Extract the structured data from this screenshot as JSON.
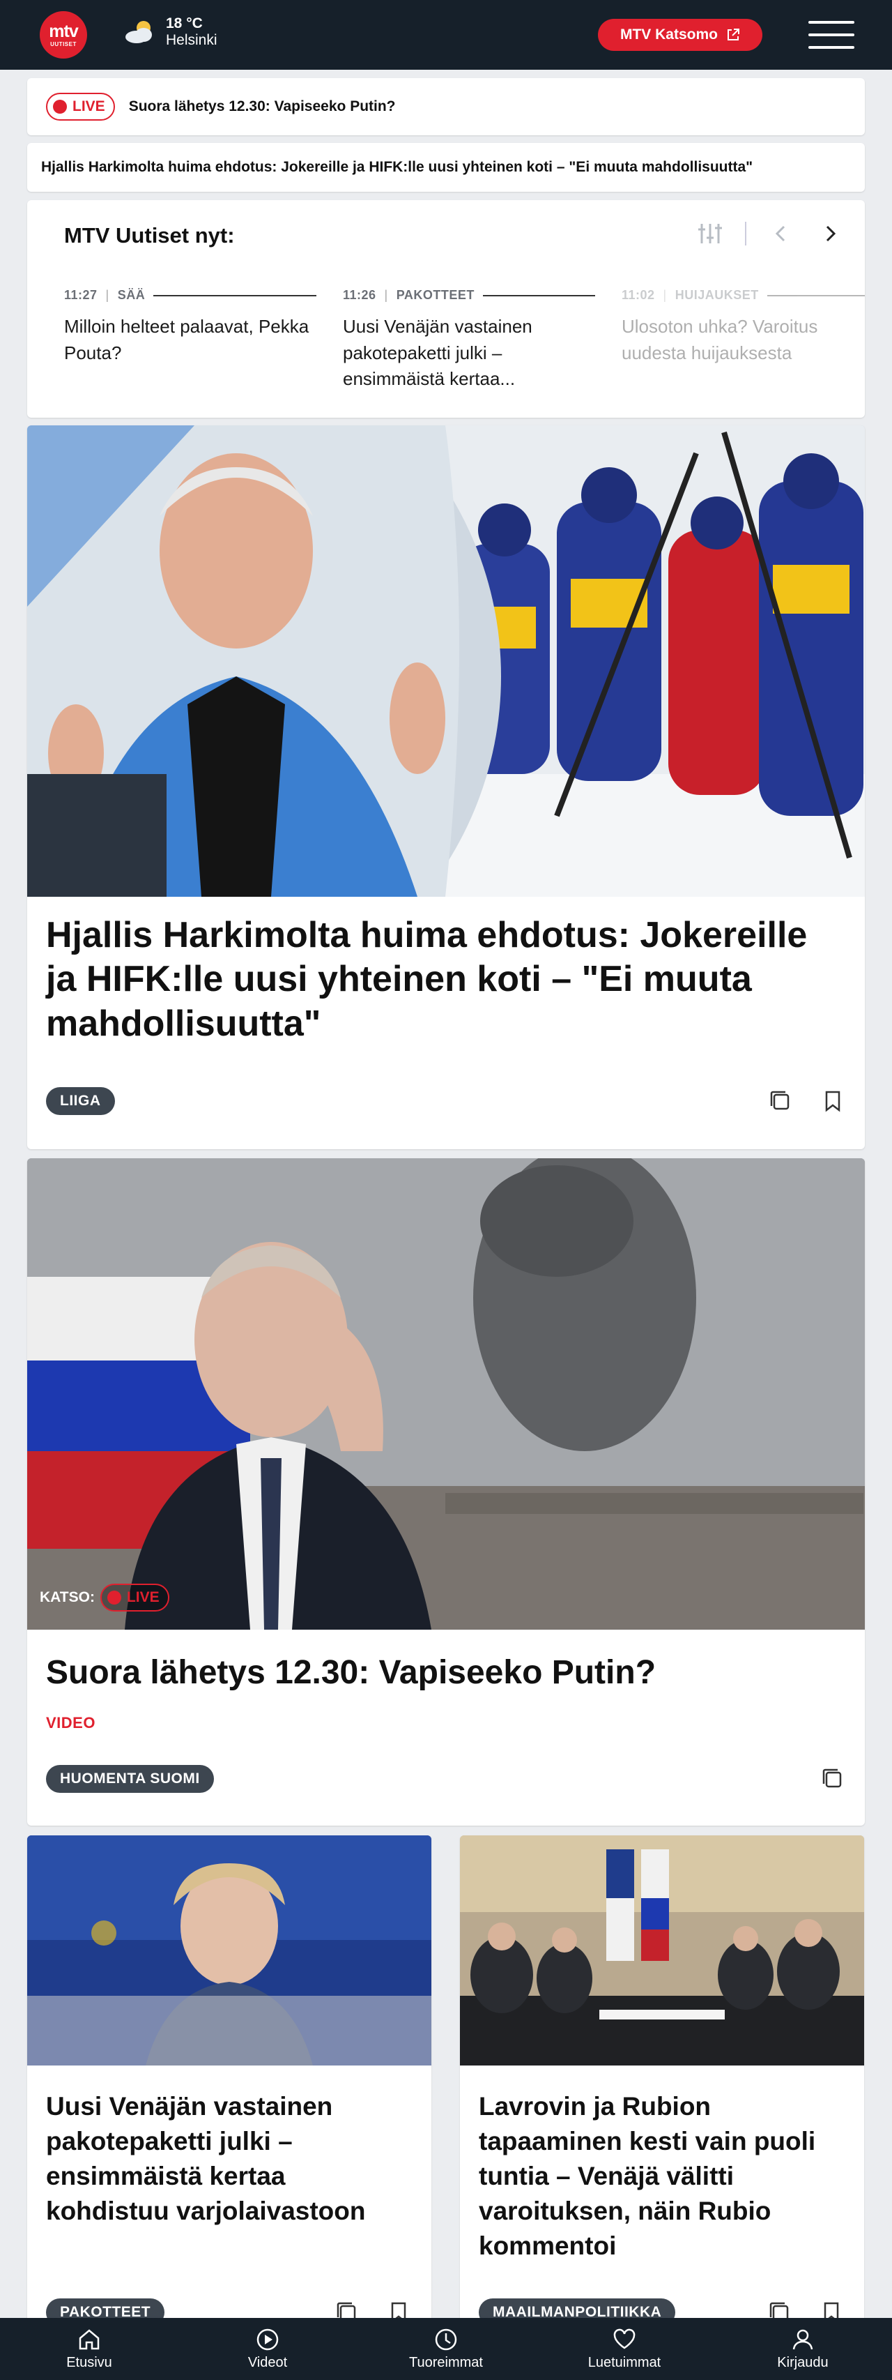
{
  "header": {
    "logo_line1": "mtv",
    "logo_line2": "UUTISET",
    "weather_temp": "18 °C",
    "weather_city": "Helsinki",
    "katsomo_label": "MTV Katsomo",
    "menu_icon": "hamburger-icon"
  },
  "live_strip": {
    "badge": "LIVE",
    "title": "Suora lähetys 12.30: Vapiseeko Putin?"
  },
  "ticker": {
    "text": "Hjallis Harkimolta huima ehdotus: Jokereille ja HIFK:lle uusi yhteinen koti – \"Ei muuta mahdollisuutta\""
  },
  "news_now": {
    "heading": "MTV Uutiset nyt:",
    "items": [
      {
        "time": "11:27",
        "category": "SÄÄ",
        "text": "Milloin helteet palaavat, Pekka Pouta?"
      },
      {
        "time": "11:26",
        "category": "PAKOTTEET",
        "text": "Uusi Venäjän vastainen pakotepaketti julki – ensimmäistä kertaa..."
      },
      {
        "time": "11:02",
        "category": "HUIJAUKSET",
        "text": "Ulosoton uhka? Varoitus uudesta huijauksesta"
      }
    ]
  },
  "articles": [
    {
      "title": "Hjallis Harkimolta huima ehdotus: Jokereille ja HIFK:lle uusi yhteinen koti – \"Ei muuta mahdollisuutta\"",
      "tag": "LIIGA"
    },
    {
      "katso": "KATSO:",
      "live": "LIVE",
      "title": "Suora lähetys 12.30: Vapiseeko Putin?",
      "label": "VIDEO",
      "tag": "HUOMENTA SUOMI"
    },
    {
      "title": "Uusi Venäjän vastainen pakotepaketti julki – ensimmäistä kertaa kohdistuu varjolaivastoon",
      "tag": "PAKOTTEET"
    },
    {
      "title": "Lavrovin ja Rubion tapaaminen kesti vain puoli tuntia – Venäjä välitti varoituksen, näin Rubio kommentoi",
      "tag": "MAAILMANPOLITIIKKA"
    }
  ],
  "bottom_nav": [
    {
      "label": "Etusivu",
      "icon": "home-icon"
    },
    {
      "label": "Videot",
      "icon": "play-icon"
    },
    {
      "label": "Tuoreimmat",
      "icon": "clock-icon"
    },
    {
      "label": "Luetuimmat",
      "icon": "heart-icon"
    },
    {
      "label": "Kirjaudu",
      "icon": "user-icon"
    }
  ],
  "colors": {
    "brand_red": "#e0202e",
    "header_bg": "#16202a",
    "tag_bg": "#3d4650",
    "page_bg": "#ebedf0"
  }
}
